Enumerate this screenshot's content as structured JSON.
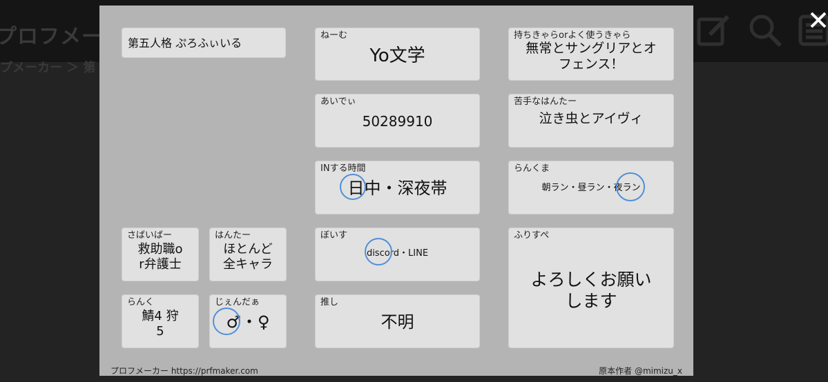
{
  "background": {
    "site_title": "プロフメーカー",
    "breadcrumb": "プメーカー ＞ 第",
    "icons": [
      "edit-icon",
      "search-icon",
      "list-icon"
    ],
    "close_icon": "close-icon"
  },
  "profile": {
    "title": "第五人格 ぷろふぃいる",
    "name": {
      "label": "ねーむ",
      "value": "Yo文学"
    },
    "id": {
      "label": "あいでぃ",
      "value": "50289910"
    },
    "in_time": {
      "label": "INする時間",
      "value": "日中・深夜帯"
    },
    "voice": {
      "label": "ぼいす",
      "value": "discord・LINE"
    },
    "oshi": {
      "label": "推し",
      "value": "不明"
    },
    "main_chars": {
      "label": "持ちきゃらorよく使うきゃら",
      "value_line1": "無常とサングリアとオ",
      "value_line2": "フェンス！"
    },
    "weak": {
      "label": "苦手なはんたー",
      "value": "泣き虫とアイヴィ"
    },
    "rank_match": {
      "label": "らんくま",
      "value": "朝ラン・昼ラン・夜ラン"
    },
    "free": {
      "label": "ふりすぺ",
      "value_line1": "よろしくお願い",
      "value_line2": "します"
    },
    "survivor": {
      "label": "さばいばー",
      "value_line1": "救助職o",
      "value_line2": "r弁護士"
    },
    "hunter": {
      "label": "はんたー",
      "value_line1": "ほとんど",
      "value_line2": "全キャラ"
    },
    "rank": {
      "label": "らんく",
      "value_line1": "鯖4 狩",
      "value_line2": "5"
    },
    "gender": {
      "label": "じぇんだぁ",
      "value": "♂・♀"
    },
    "footer_left": "プロフメーカー https://prfmaker.com",
    "footer_right": "原本作者 @mimizu_x"
  },
  "colors": {
    "page_bg": "#232323",
    "modal_bg": "#b4b4b4",
    "card_bg": "#e1e1e1",
    "circle_mark": "#4f8fd8"
  }
}
